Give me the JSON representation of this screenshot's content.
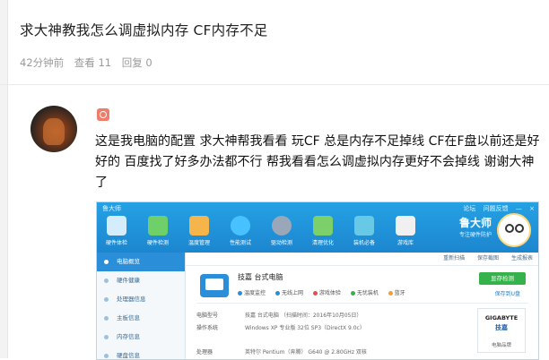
{
  "post": {
    "title": "求大神教我怎么调虚拟内存  CF内存不足",
    "meta": {
      "time": "42分钟前",
      "views": "查看 11",
      "replies": "回复 0"
    },
    "body": "这是我电脑的配置   求大神帮我看看   玩CF  总是内存不足掉线   CF在F盘以前还是好好的  百度找了好多办法都不行   帮我看看怎么调虚拟内存更好不会掉线   谢谢大神了"
  },
  "screenshot": {
    "app_name": "鲁大师",
    "window_controls": [
      "论坛",
      "问题反馈",
      "—",
      "×"
    ],
    "tools": [
      {
        "label": "硬件体检",
        "color": "#ffffff"
      },
      {
        "label": "硬件检测",
        "color": "#6fd06a"
      },
      {
        "label": "温度管理",
        "color": "#f5b54a"
      },
      {
        "label": "性能测试",
        "color": "#47c1ff"
      },
      {
        "label": "驱动检测",
        "color": "#9aa7b8"
      },
      {
        "label": "清理优化",
        "color": "#7bd06a"
      },
      {
        "label": "装机必备",
        "color": "#67c9e6"
      },
      {
        "label": "游戏库",
        "color": "#f0f0f0"
      }
    ],
    "brand": {
      "name": "鲁大师",
      "tagline": "专注硬件防护"
    },
    "sidebar": [
      "电脑概览",
      "硬件健康",
      "处理器信息",
      "主板信息",
      "内存信息",
      "硬盘信息"
    ],
    "toolbar": [
      "重新扫描",
      "保存截图",
      "生成报表"
    ],
    "pc_name": "技嘉  台式电脑",
    "status": [
      {
        "label": "温度监控",
        "color": "#2a8ed8"
      },
      {
        "label": "无线上网",
        "color": "#2a8ed8"
      },
      {
        "label": "游戏体验",
        "color": "#e05050"
      },
      {
        "label": "无忧装机",
        "color": "#36b24a"
      },
      {
        "label": "蓝牙",
        "color": "#f0a030"
      }
    ],
    "primary_button": "显存检测",
    "save_link": "保存到U盘",
    "specs": [
      {
        "k": "电脑型号",
        "v": "技嘉 台式电脑  （扫描时间：2016年10月05日）"
      },
      {
        "k": "操作系统",
        "v": "Windows XP 专业版 32位 SP3（DirectX 9.0c）"
      },
      {
        "k": "处理器",
        "v": "英特尔 Pentium（奔腾） G640 @ 2.80GHz 双核"
      }
    ],
    "vendor": {
      "logo": "GIGABYTE",
      "name": "技嘉",
      "caption": "电脑品牌"
    }
  }
}
